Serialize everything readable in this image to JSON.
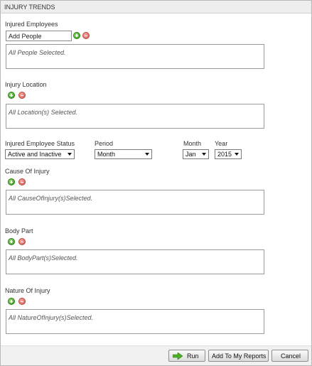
{
  "title": "INJURY TRENDS",
  "injured_employees": {
    "label": "Injured Employees",
    "add_placeholder": "Add People",
    "selection_text": "All People Selected."
  },
  "injury_location": {
    "label": "Injury Location",
    "selection_text": "All Location(s) Selected."
  },
  "filters": {
    "status_label": "Injured Employee Status",
    "status_value": "Active and Inactive",
    "period_label": "Period",
    "period_value": "Month",
    "month_label": "Month",
    "month_value": "Jan",
    "year_label": "Year",
    "year_value": "2015"
  },
  "cause_of_injury": {
    "label": "Cause Of Injury",
    "selection_text": "All CauseOfInjury(s)Selected."
  },
  "body_part": {
    "label": "Body Part",
    "selection_text": "All BodyPart(s)Selected."
  },
  "nature_of_injury": {
    "label": "Nature Of Injury",
    "selection_text": "All NatureOfInjury(s)Selected."
  },
  "buttons": {
    "run": "Run",
    "add_to_reports": "Add To My Reports",
    "cancel": "Cancel"
  },
  "colors": {
    "add_icon": "#3a9b1e",
    "remove_icon": "#d75a52",
    "run_arrow": "#4caf28"
  }
}
